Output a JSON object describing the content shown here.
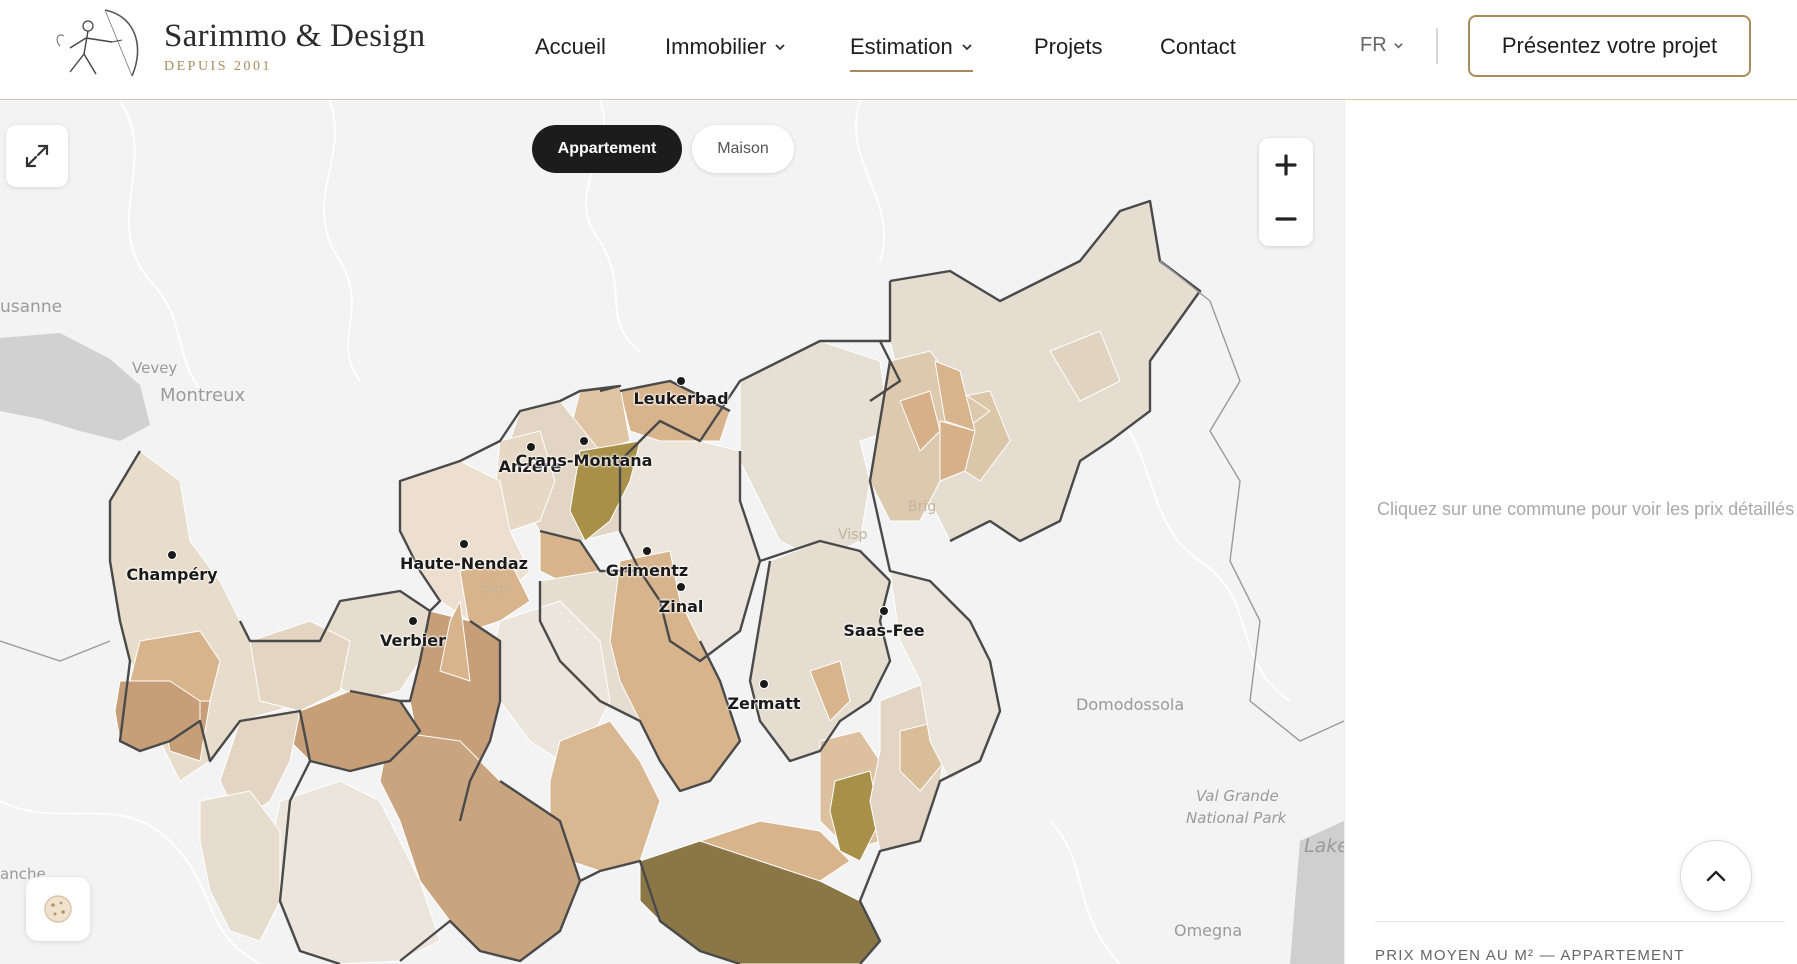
{
  "brand": {
    "name": "Sarimmo & Design",
    "tagline": "DEPUIS 2001"
  },
  "nav": {
    "items": [
      {
        "label": "Accueil",
        "dropdown": false
      },
      {
        "label": "Immobilier",
        "dropdown": true
      },
      {
        "label": "Estimation",
        "dropdown": true,
        "active": true
      },
      {
        "label": "Projets",
        "dropdown": false
      },
      {
        "label": "Contact",
        "dropdown": false
      }
    ],
    "language": "FR",
    "cta_label": "Présentez votre projet"
  },
  "map": {
    "toggle": {
      "active": "Appartement",
      "inactive": "Maison"
    },
    "places": [
      {
        "name": "usanne"
      },
      {
        "name": "Vevey"
      },
      {
        "name": "Montreux"
      },
      {
        "name": "Domodossola"
      },
      {
        "name": "Val Grande"
      },
      {
        "name": "National Park"
      },
      {
        "name": "Lake"
      },
      {
        "name": "Omegna"
      },
      {
        "name": "anche"
      },
      {
        "name": "Brig"
      },
      {
        "name": "Sion"
      },
      {
        "name": "Visp"
      }
    ],
    "communes": [
      {
        "name": "Leukerbad"
      },
      {
        "name": "Anzère"
      },
      {
        "name": "Crans-Montana"
      },
      {
        "name": "Champéry"
      },
      {
        "name": "Haute-Nendaz"
      },
      {
        "name": "Grimentz"
      },
      {
        "name": "Zinal"
      },
      {
        "name": "Verbier"
      },
      {
        "name": "Saas-Fee"
      },
      {
        "name": "Zermatt"
      }
    ],
    "colors": {
      "low": "#e7dfd3",
      "mid": "#d7b48c",
      "high": "#c69f79",
      "premium": "#a89048",
      "top": "#8b7645",
      "border": "#4a4a4a"
    }
  },
  "panel": {
    "hint": "Cliquez sur une commune pour voir les prix détaillés",
    "footer": "PRIX MOYEN AU M² — APPARTEMENT"
  }
}
